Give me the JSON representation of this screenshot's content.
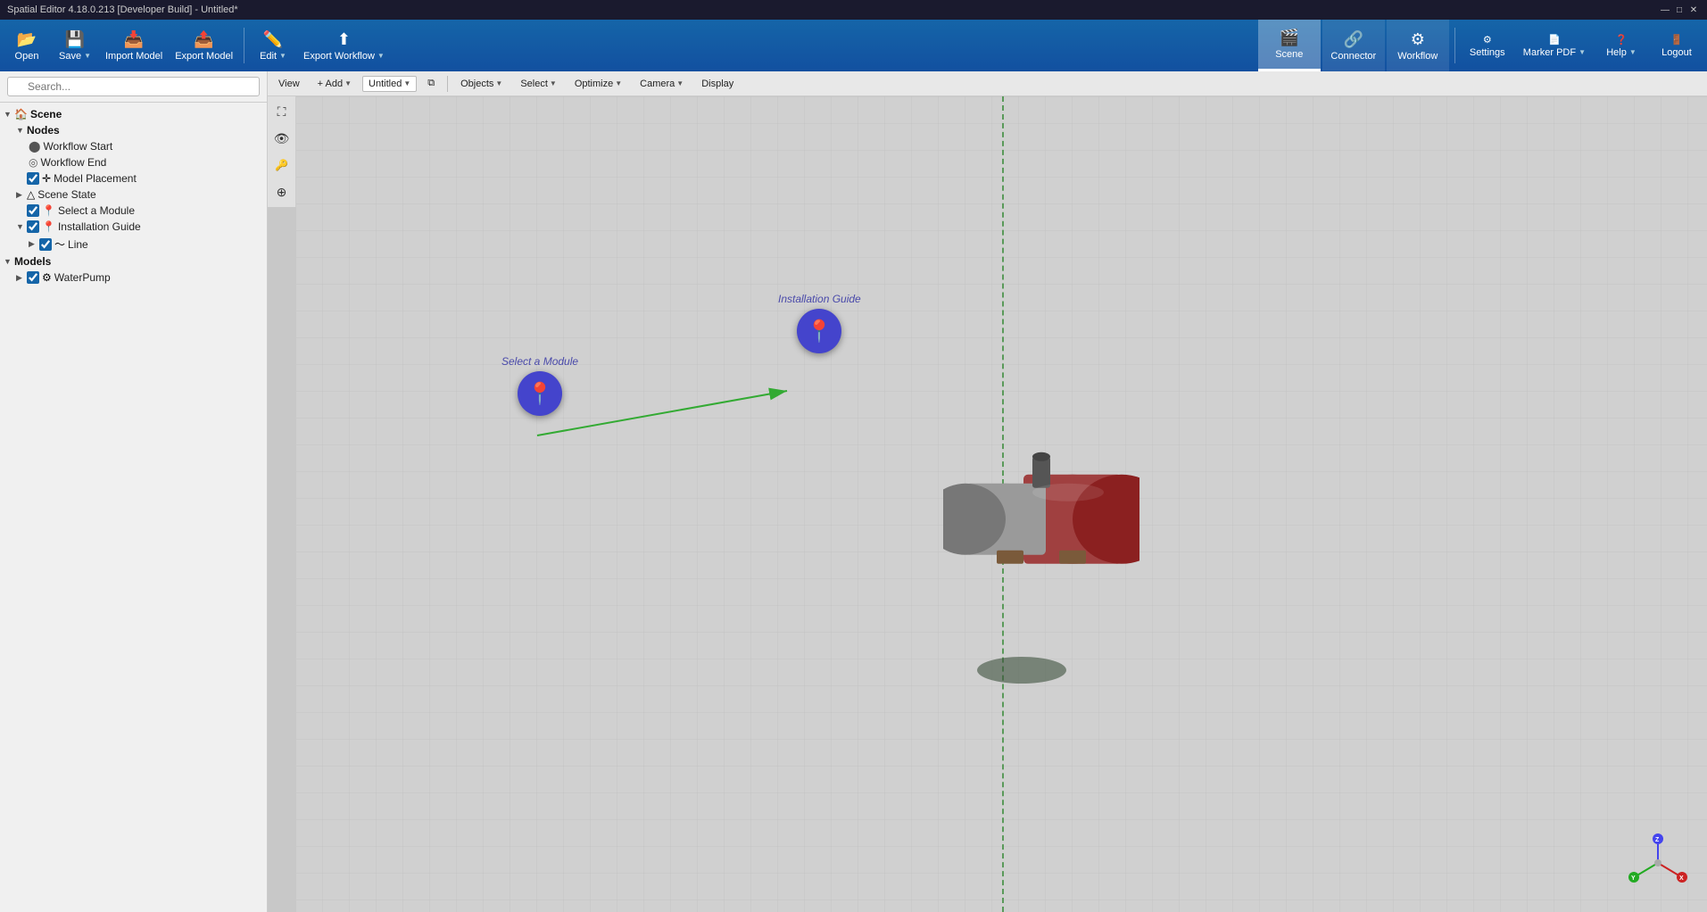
{
  "app": {
    "title": "Spatial Editor 4.18.0.213 [Developer Build] - Untitled*",
    "version": "4.18.0.213"
  },
  "titlebar": {
    "title": "Spatial Editor 4.18.0.213 [Developer Build] - Untitled*",
    "minimize": "—",
    "maximize": "□",
    "close": "✕"
  },
  "toolbar": {
    "open_label": "Open",
    "save_label": "Save",
    "import_model_label": "Import Model",
    "export_model_label": "Export Model",
    "edit_label": "Edit",
    "export_workflow_label": "Export Workflow",
    "scene_label": "Scene",
    "connector_label": "Connector",
    "workflow_label": "Workflow",
    "settings_label": "Settings",
    "marker_pdf_label": "Marker PDF",
    "help_label": "Help",
    "logout_label": "Logout"
  },
  "viewport_toolbar": {
    "view_label": "View",
    "add_label": "+ Add",
    "untitled_label": "Untitled",
    "copy_icon": "⧉",
    "objects_label": "Objects",
    "select_label": "Select",
    "optimize_label": "Optimize",
    "camera_label": "Camera",
    "display_label": "Display"
  },
  "viewport_controls": {
    "expand_icon": "⛶",
    "eye_icon": "👁",
    "key_icon": "🔑",
    "zoom_icon": "⊕"
  },
  "scene_tree": {
    "scene_label": "Scene",
    "nodes_label": "Nodes",
    "workflow_start_label": "Workflow Start",
    "workflow_end_label": "Workflow End",
    "model_placement_label": "Model Placement",
    "scene_state_label": "Scene State",
    "select_module_label": "Select a Module",
    "installation_guide_label": "Installation Guide",
    "line_label": "Line",
    "models_label": "Models",
    "water_pump_label": "WaterPump"
  },
  "scene_3d": {
    "poi1_label": "Select a Module",
    "poi2_label": "Installation Guide"
  },
  "search": {
    "placeholder": "Search..."
  },
  "xyz": {
    "z_color": "#4444ee",
    "x_color": "#cc2222",
    "y_color": "#22aa22",
    "center_color": "#aaaaaa"
  }
}
